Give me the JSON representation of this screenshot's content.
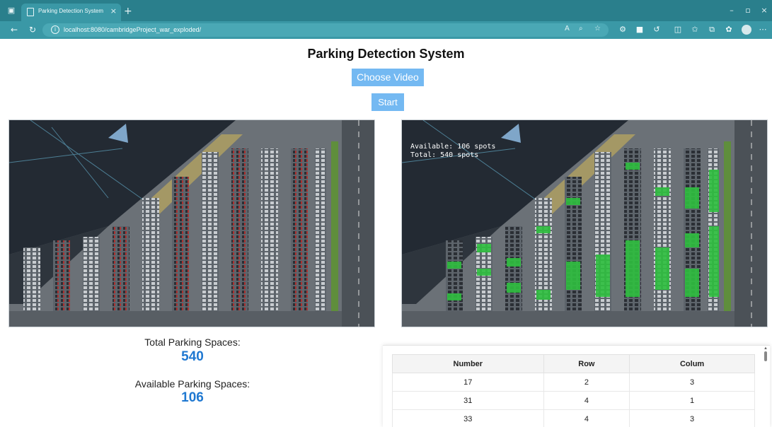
{
  "browser": {
    "tab_title": "Parking Detection System",
    "url": "localhost:8080/cambridgeProject_war_exploded/"
  },
  "page": {
    "title": "Parking Detection System",
    "choose_video_label": "Choose Video",
    "start_label": "Start"
  },
  "overlay": {
    "available_text": "Available: 106 spots",
    "total_text": "Total: 540 spots"
  },
  "stats": {
    "total_label": "Total Parking Spaces:",
    "total_value": "540",
    "available_label": "Available Parking Spaces:",
    "available_value": "106"
  },
  "table": {
    "headers": [
      "Number",
      "Row",
      "Colum"
    ],
    "rows": [
      [
        "17",
        "2",
        "3"
      ],
      [
        "31",
        "4",
        "1"
      ],
      [
        "33",
        "4",
        "3"
      ]
    ]
  },
  "colors": {
    "browser_frame": "#2a7f8c",
    "button": "#74b9f2",
    "stat_value": "#1f78d1",
    "free_spot": "#2fbf3f"
  }
}
